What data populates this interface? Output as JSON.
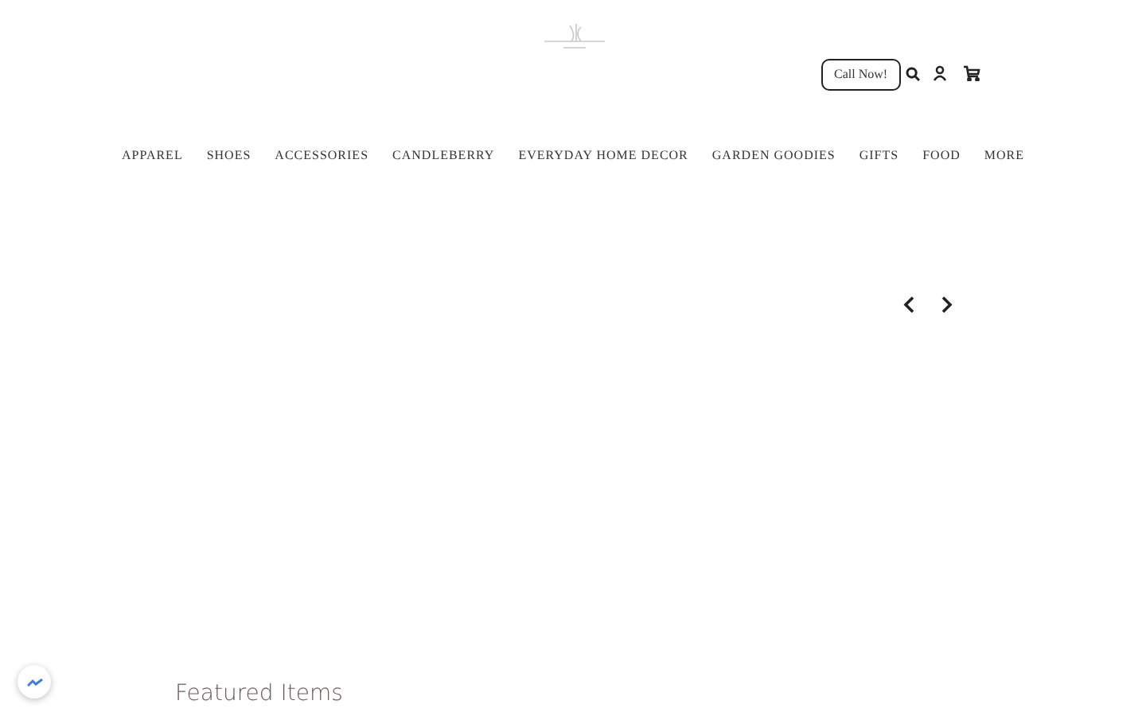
{
  "header": {
    "call_button": "Call Now!"
  },
  "nav": [
    "APPAREL",
    "SHOES",
    "ACCESSORIES",
    "CANDLEBERRY",
    "EVERYDAY HOME DECOR",
    "GARDEN GOODIES",
    "GIFTS",
    "FOOD",
    "MORE"
  ],
  "section": {
    "title": "Featured Items"
  }
}
